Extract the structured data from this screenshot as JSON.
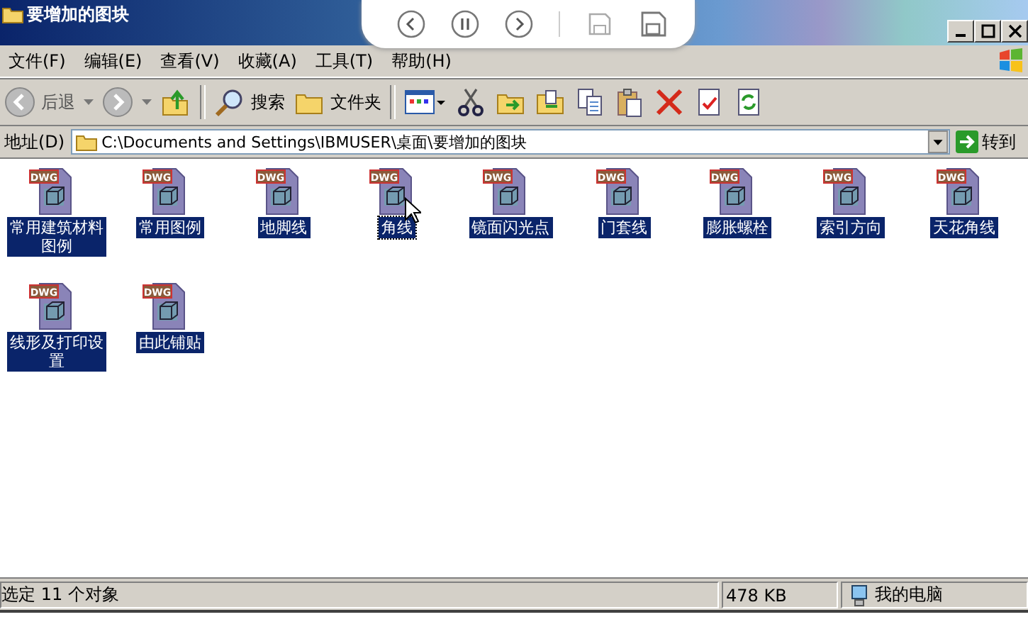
{
  "window": {
    "title": "要增加的图块"
  },
  "menu": [
    "文件(F)",
    "编辑(E)",
    "查看(V)",
    "收藏(A)",
    "工具(T)",
    "帮助(H)"
  ],
  "toolbar": {
    "back": "后退",
    "search": "搜索",
    "folders": "文件夹"
  },
  "address": {
    "label": "地址(D)",
    "value": "C:\\Documents and Settings\\IBMUSER\\桌面\\要增加的图块",
    "go": "转到"
  },
  "files": [
    {
      "name": "常用建筑材料图例",
      "badge": "DWG",
      "selected": true,
      "focused": false
    },
    {
      "name": "常用图例",
      "badge": "DWG",
      "selected": true,
      "focused": false
    },
    {
      "name": "地脚线",
      "badge": "DWG",
      "selected": true,
      "focused": false
    },
    {
      "name": "角线",
      "badge": "DWG",
      "selected": true,
      "focused": true
    },
    {
      "name": "镜面闪光点",
      "badge": "DWG",
      "selected": true,
      "focused": false
    },
    {
      "name": "门套线",
      "badge": "DWG",
      "selected": true,
      "focused": false
    },
    {
      "name": "膨胀螺栓",
      "badge": "DWG",
      "selected": true,
      "focused": false
    },
    {
      "name": "索引方向",
      "badge": "DWG",
      "selected": true,
      "focused": false
    },
    {
      "name": "天花角线",
      "badge": "DWG",
      "selected": true,
      "focused": false
    },
    {
      "name": "线形及打印设置",
      "badge": "DWG",
      "selected": true,
      "focused": false
    },
    {
      "name": "由此铺贴",
      "badge": "DWG",
      "selected": true,
      "focused": false
    }
  ],
  "status_bar": {
    "message": "选定 11 个对象",
    "size": "478 KB",
    "zone": "我的电脑"
  }
}
